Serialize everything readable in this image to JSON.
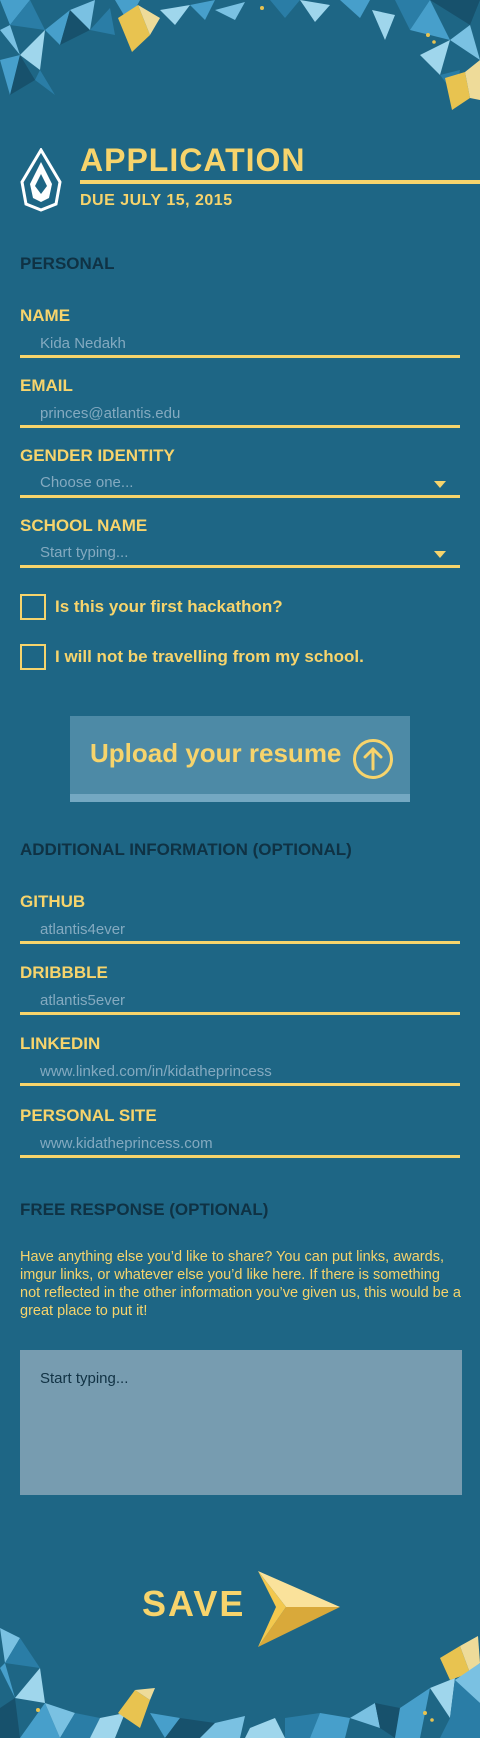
{
  "header": {
    "title": "APPLICATION",
    "due": "DUE JULY 15, 2015"
  },
  "sections": {
    "personal": "PERSONAL",
    "additional": "ADDITIONAL INFORMATION (OPTIONAL)",
    "free_response": "FREE RESPONSE (OPTIONAL)"
  },
  "personal": {
    "name": {
      "label": "NAME",
      "placeholder": "Kida Nedakh"
    },
    "email": {
      "label": "EMAIL",
      "placeholder": "princes@atlantis.edu"
    },
    "gender": {
      "label": "GENDER IDENTITY",
      "placeholder": "Choose one..."
    },
    "school": {
      "label": "SCHOOL NAME",
      "placeholder": "Start typing..."
    },
    "first_hackathon": "Is this your first hackathon?",
    "not_travelling": "I will not be travelling from my school."
  },
  "upload": {
    "label": "Upload your resume"
  },
  "additional": {
    "github": {
      "label": "GITHUB",
      "placeholder": "atlantis4ever"
    },
    "dribbble": {
      "label": "DRIBBBLE",
      "placeholder": "atlantis5ever"
    },
    "linkedin": {
      "label": "LINKEDIN",
      "placeholder": "www.linked.com/in/kidatheprincess"
    },
    "site": {
      "label": "PERSONAL SITE",
      "placeholder": "www.kidatheprincess.com"
    }
  },
  "free_response": {
    "prompt": "Have anything else you’d like to share? You can put links, awards, imgur links, or whatever else you’d like here. If there is something not reflected in the other information you’ve given us, this would be a great place to put it!",
    "placeholder": "Start typing..."
  },
  "save": {
    "label": "SAVE"
  },
  "colors": {
    "background": "#1e6685",
    "accent": "#f7d46c",
    "dark_text": "#0f3244",
    "button": "#4d8aa6",
    "textarea": "#779cb0"
  },
  "icons": {
    "logo": "crystal-logo-icon",
    "upload": "upload-arrow-icon",
    "save": "paper-plane-icon"
  }
}
